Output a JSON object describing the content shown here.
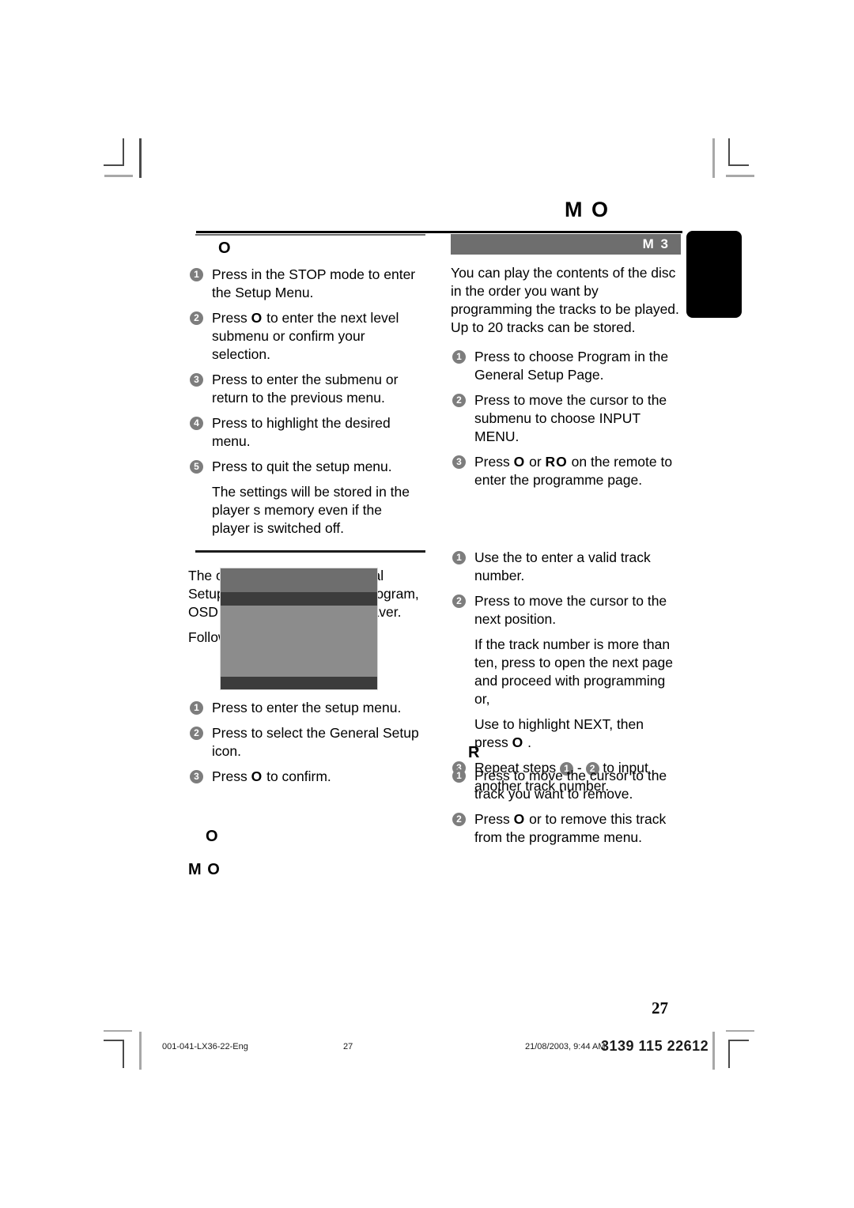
{
  "document": {
    "page_number": "27",
    "header_title": "M         O",
    "edge_tab": "",
    "accent_gray": "#6e6e6e",
    "band_text_color": "#ffffff"
  },
  "left_column": {
    "section_title": "O",
    "steps": [
      {
        "n": "1",
        "text": "Press             in the STOP mode to enter the Setup Menu."
      },
      {
        "n": "2",
        "text": "Press ",
        "glyph": "O",
        "rest": "   to enter the next level submenu or confirm your selection."
      },
      {
        "n": "3",
        "text": "Press           to enter the submenu or return to the previous menu."
      },
      {
        "n": "4",
        "text": "Press          to highlight the desired menu."
      },
      {
        "n": "5",
        "text": "Press                to quit the setup menu."
      }
    ],
    "step5_note": "The settings will be stored in the player s memory even if the player is switched off.",
    "general_setup_intro": "The options included in General Setup menu are: Disc Lock, Program, OSD Language and Screen Saver.",
    "follow_steps": "Follow the steps below:",
    "figure_caption": "",
    "setup_steps": [
      {
        "n": "1",
        "text": "Press              to enter the setup menu."
      },
      {
        "n": "2",
        "text": "Press        to select the General Setup icon."
      },
      {
        "n": "3",
        "text": "Press ",
        "glyph": "O",
        "rest": "   to confirm."
      }
    ],
    "footer_heading_1": "O",
    "footer_heading_2": "M    O"
  },
  "right_column": {
    "band_heading": "M  3",
    "intro": "You can play the contents of the disc in the order you want by programming the tracks to be played. Up to 20 tracks can be stored.",
    "steps": [
      {
        "n": "1",
        "text": "Press        to choose Program  in the General Setup Page."
      },
      {
        "n": "2",
        "text": "Press     to move the cursor to the submenu to choose INPUT MENU."
      },
      {
        "n": "3",
        "pre": "Press ",
        "glyph1": "O",
        "mid": "  or  ",
        "glyph2": "RO",
        "post": "   on the remote to enter the programme page."
      }
    ],
    "input_steps": [
      {
        "n": "1",
        "text": "Use the                            to enter a valid track number."
      },
      {
        "n": "2",
        "text": "Press             to move the cursor to the next position."
      }
    ],
    "note_more_than_ten_a": "If the track number is more than ten, press        to open the next page and proceed with programming or,",
    "note_more_than_ten_b": "Use               to highlight NEXT, then",
    "note_more_than_ten_c_pre": "press ",
    "note_more_than_ten_c_glyph": "O",
    "note_more_than_ten_c_post": "  .",
    "repeat_step": {
      "n": "3",
      "pre": "Repeat steps ",
      "a": "1",
      "sep": " - ",
      "b": "2",
      "post": " to input another track number."
    },
    "remove_heading": "R",
    "remove_steps": [
      {
        "n": "1",
        "text": "Press             to move the cursor to the track you want to remove."
      },
      {
        "n": "2",
        "pre": "Press ",
        "glyph": "O",
        "mid": "   or           ",
        "post": " to remove this track from the programme menu."
      }
    ]
  },
  "print_footer": {
    "file_name": "001-041-LX36-22-Eng",
    "page": "27",
    "timestamp": "21/08/2003, 9:44 AM",
    "product_code": "3139 115 22612"
  }
}
